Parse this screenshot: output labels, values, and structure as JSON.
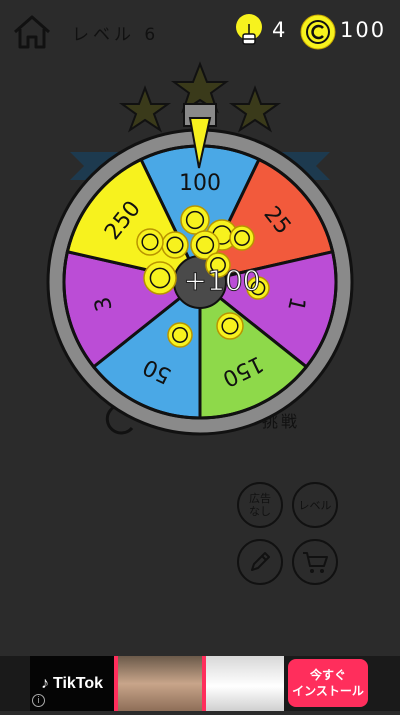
{
  "header": {
    "level_label": "レベル 6",
    "hint_count": "4",
    "coin_count": "100"
  },
  "wheel": {
    "segments": [
      {
        "label": "100",
        "color": "#4aa8e6"
      },
      {
        "label": "25",
        "color": "#f25a3c"
      },
      {
        "label": "1",
        "color": "#bb4dd6"
      },
      {
        "label": "150",
        "color": "#8ed94a"
      },
      {
        "label": "50",
        "color": "#4aa8e6"
      },
      {
        "label": "3",
        "color": "#bb4dd6"
      },
      {
        "label": "250",
        "color": "#f7f21e"
      }
    ],
    "reward_text": "+100",
    "rim_color": "#8a8a8a",
    "pointer_color": "#f7f21e"
  },
  "menu": {
    "retry_label": "挑戦",
    "no_ads_label_1": "広告",
    "no_ads_label_2": "なし",
    "level_button_label": "レベル"
  },
  "ad": {
    "brand": "TikTok",
    "cta_line1": "今すぐ",
    "cta_line2": "インストール",
    "info": "i"
  },
  "icons": {
    "home": "home-icon",
    "hint": "lightbulb-icon",
    "coin": "coin-icon",
    "pencil": "pencil-icon",
    "cart": "cart-icon",
    "retry": "retry-icon"
  }
}
